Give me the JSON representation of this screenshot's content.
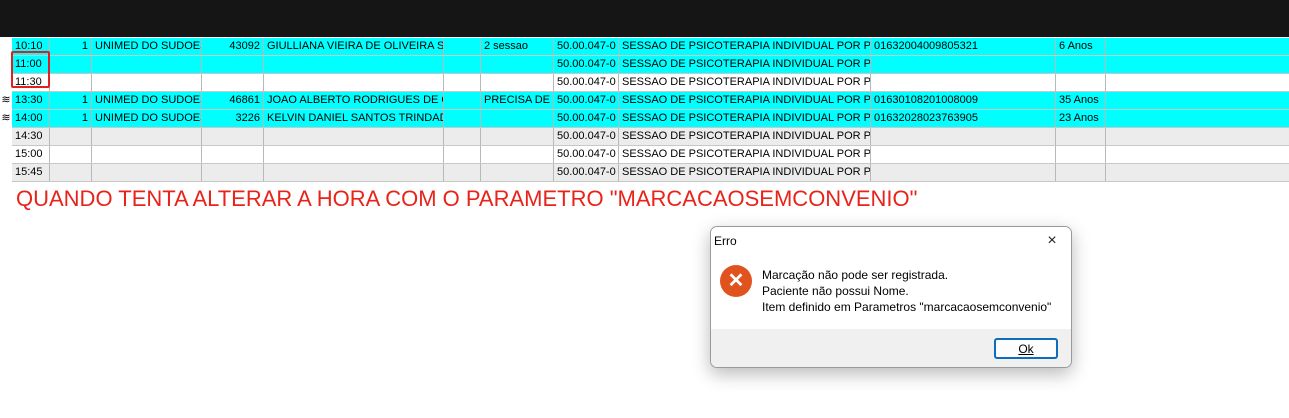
{
  "schedule": {
    "rows": [
      {
        "style": "cyan",
        "icon": "",
        "time": "10:10",
        "qty": "1",
        "plan": "UNIMED DO SUDOEST",
        "code": "43092",
        "patient": "GIULLIANA VIEIRA DE OLIVEIRA SILV",
        "c5": "",
        "note": "2 sessao",
        "proc_code": "50.00.047-0",
        "procedure": "SESSAO DE PSICOTERAPIA INDIVIDUAL POR PSICO",
        "card": "01632004009805321",
        "age": "6 Anos",
        "c11": ""
      },
      {
        "style": "cyan",
        "icon": "",
        "time": "11:00",
        "qty": "",
        "plan": "",
        "code": "",
        "patient": "",
        "c5": "",
        "note": "",
        "proc_code": "50.00.047-0",
        "procedure": "SESSAO DE PSICOTERAPIA INDIVIDUAL POR PSICO",
        "card": "",
        "age": "",
        "c11": ""
      },
      {
        "style": "white",
        "icon": "",
        "time": "11:30",
        "qty": "",
        "plan": "",
        "code": "",
        "patient": "",
        "c5": "",
        "note": "",
        "proc_code": "50.00.047-0",
        "procedure": "SESSAO DE PSICOTERAPIA INDIVIDUAL POR PSICO",
        "card": "",
        "age": "",
        "c11": ""
      },
      {
        "style": "cyan",
        "icon": "≋",
        "time": "13:30",
        "qty": "1",
        "plan": "UNIMED DO SUDOEST",
        "code": "46861",
        "patient": "JOAO ALBERTO RODRIGUES DE OLI",
        "c5": "",
        "note": "PRECISA DE R",
        "proc_code": "50.00.047-0",
        "procedure": "SESSAO DE PSICOTERAPIA INDIVIDUAL POR PSICO",
        "card": "01630108201008009",
        "age": "35 Anos",
        "c11": ""
      },
      {
        "style": "cyan",
        "icon": "≋",
        "time": "14:00",
        "qty": "1",
        "plan": "UNIMED DO SUDOEST",
        "code": "3226",
        "patient": "KELVIN DANIEL SANTOS TRINDADE",
        "c5": "",
        "note": "",
        "proc_code": "50.00.047-0",
        "procedure": "SESSAO DE PSICOTERAPIA INDIVIDUAL POR PSICO",
        "card": "01632028023763905",
        "age": "23 Anos",
        "c11": ""
      },
      {
        "style": "gray",
        "icon": "",
        "time": "14:30",
        "qty": "",
        "plan": "",
        "code": "",
        "patient": "",
        "c5": "",
        "note": "",
        "proc_code": "50.00.047-0",
        "procedure": "SESSAO DE PSICOTERAPIA INDIVIDUAL POR PSICO",
        "card": "",
        "age": "",
        "c11": ""
      },
      {
        "style": "white",
        "icon": "",
        "time": "15:00",
        "qty": "",
        "plan": "",
        "code": "",
        "patient": "",
        "c5": "",
        "note": "",
        "proc_code": "50.00.047-0",
        "procedure": "SESSAO DE PSICOTERAPIA INDIVIDUAL POR PSICO",
        "card": "",
        "age": "",
        "c11": ""
      },
      {
        "style": "gray",
        "icon": "",
        "time": "15:45",
        "qty": "",
        "plan": "",
        "code": "",
        "patient": "",
        "c5": "",
        "note": "",
        "proc_code": "50.00.047-0",
        "procedure": "SESSAO DE PSICOTERAPIA INDIVIDUAL POR PSICO",
        "card": "",
        "age": "",
        "c11": ""
      }
    ]
  },
  "annotation": {
    "text": "QUANDO TENTA ALTERAR A HORA COM O PARAMETRO \"MARCACAOSEMCONVENIO\"",
    "color": "#e8231a"
  },
  "dialog": {
    "title": "Erro",
    "close_icon": "×",
    "error_icon": "✕",
    "line1": "Marcação não pode ser registrada.",
    "line2": "Paciente não possui Nome.",
    "line3": "Item definido em Parametros \"marcacaosemconvenio\"",
    "ok_label": "Ok"
  },
  "colors": {
    "row_cyan": "#00ffff",
    "row_gray": "#ececec",
    "highlight_border": "#e02020",
    "error_icon_bg": "#e0531f",
    "ok_border": "#0f6cbd"
  }
}
